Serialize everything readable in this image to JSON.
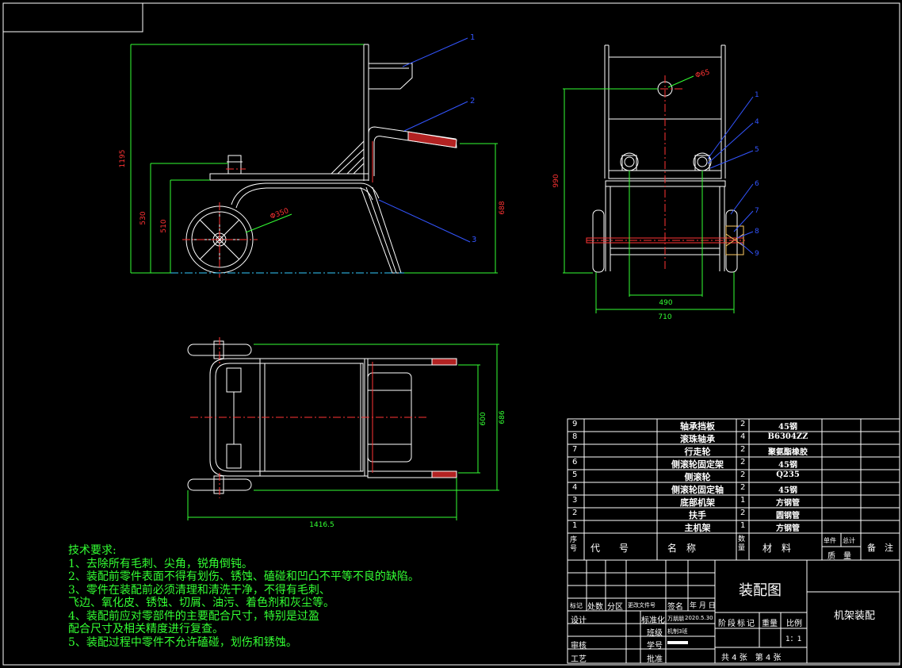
{
  "colors": {
    "background": "#000000",
    "lines": "#ffffff",
    "dims": "#33ff33",
    "center": "#ff3333",
    "leaders": "#3355ff",
    "axle": "#ffcc66"
  },
  "dimensions": {
    "side_height": "1195",
    "side_h2": "530",
    "side_h3": "510",
    "side_h4": "688",
    "wheel_dia": "Φ350",
    "end_height": "990",
    "hole_dia": "Φ65",
    "end_w1": "490",
    "end_w2": "710",
    "plan_length": "1416.5",
    "plan_w1": "600",
    "plan_w2": "686"
  },
  "balloons": {
    "side": [
      "1",
      "2",
      "3"
    ],
    "end": [
      "1",
      "4",
      "5",
      "6",
      "7",
      "8",
      "9"
    ]
  },
  "notes": {
    "title": "技术要求:",
    "lines": [
      "1、去除所有毛刺、尖角，锐角倒钝。",
      "2、装配前零件表面不得有划伤、锈蚀、磕碰和凹凸不平等不良的缺陷。",
      "3、零件在装配前必须清理和清洗干净，不得有毛刺、",
      "飞边、氧化皮、锈蚀、切屑、油污、着色剂和灰尘等。",
      "4、装配前应对零部件的主要配合尺寸，特别是过盈",
      "配合尺寸及相关精度进行复查。",
      "5、装配过程中零件不允许磕碰，划伤和锈蚀。"
    ]
  },
  "bom": {
    "rows": [
      {
        "no": "9",
        "name": "轴承挡板",
        "qty": "2",
        "material": "45钢"
      },
      {
        "no": "8",
        "name": "滚珠轴承",
        "qty": "4",
        "material": "B6304ZZ"
      },
      {
        "no": "7",
        "name": "行走轮",
        "qty": "2",
        "material": "聚氨酯橡胶"
      },
      {
        "no": "6",
        "name": "侧滚轮固定架",
        "qty": "2",
        "material": "45钢"
      },
      {
        "no": "5",
        "name": "侧滚轮",
        "qty": "2",
        "material": "Q235"
      },
      {
        "no": "4",
        "name": "侧滚轮固定轴",
        "qty": "2",
        "material": "45钢"
      },
      {
        "no": "3",
        "name": "底部机架",
        "qty": "1",
        "material": "方钢管"
      },
      {
        "no": "2",
        "name": "扶手",
        "qty": "2",
        "material": "圆钢管"
      },
      {
        "no": "1",
        "name": "主机架",
        "qty": "1",
        "material": "方钢管"
      }
    ],
    "header": {
      "no": "序号",
      "code": "代　　号",
      "name": "名　称",
      "qty": "数量",
      "material": "材　料",
      "single": "单件",
      "total": "总计",
      "mass": "质　量",
      "remark": "备　注"
    }
  },
  "title_block": {
    "drawing_title": "装配图",
    "drawing_name": "机架装配",
    "rev_headers": [
      "标记",
      "处数",
      "分区",
      "更改文件号",
      "签名",
      "年 月 日"
    ],
    "design": "设计",
    "standardization": "标准化",
    "designer_name": "万朋朋",
    "design_date": "2020.5.30",
    "class": "班级",
    "class_value": "机制3班",
    "review": "审核",
    "student_no": "学号",
    "process": "工艺",
    "approve": "批准",
    "stage_mark": "阶段标记",
    "weight": "重量",
    "scale": "比例",
    "scale_value": "1：1",
    "sheets": "共 4 张　第 4 张"
  }
}
